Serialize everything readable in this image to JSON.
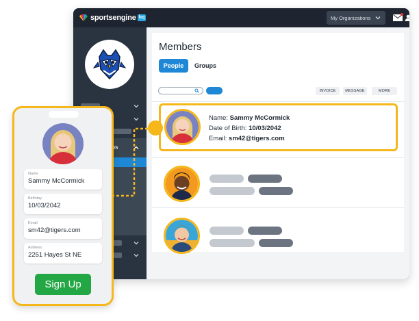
{
  "app": {
    "brand": "sportsengine",
    "brand_badge": "hq",
    "org_dropdown": "My Organizations",
    "colors": {
      "accent": "#1e88d6",
      "highlight": "#f5b719",
      "signup": "#23a745",
      "topbar": "#1e2530",
      "sidebar": "#2a3441"
    }
  },
  "sidebar": {
    "team_logo_icon": "owl-mascot-icon",
    "active_item_label": "ips"
  },
  "main": {
    "title": "Members",
    "tabs": [
      {
        "label": "People",
        "active": true
      },
      {
        "label": "Groups",
        "active": false
      }
    ],
    "search": {
      "placeholder": ""
    },
    "actions": [
      "INVOICE",
      "MESSAGE",
      "MORE"
    ]
  },
  "member": {
    "name_label": "Name:",
    "name": "Sammy McCormick",
    "dob_label": "Date of Birth:",
    "dob": "10/03/2042",
    "email_label": "Email:",
    "email": "sm42@tigers.com"
  },
  "phone_form": {
    "fields": [
      {
        "label": "Name",
        "value": "Sammy McCormick"
      },
      {
        "label": "Birthday",
        "value": "10/03/2042"
      },
      {
        "label": "Email",
        "value": "sm42@tigers.com"
      },
      {
        "label": "Address",
        "value": "2251 Hayes St NE"
      }
    ],
    "submit": "Sign Up"
  }
}
